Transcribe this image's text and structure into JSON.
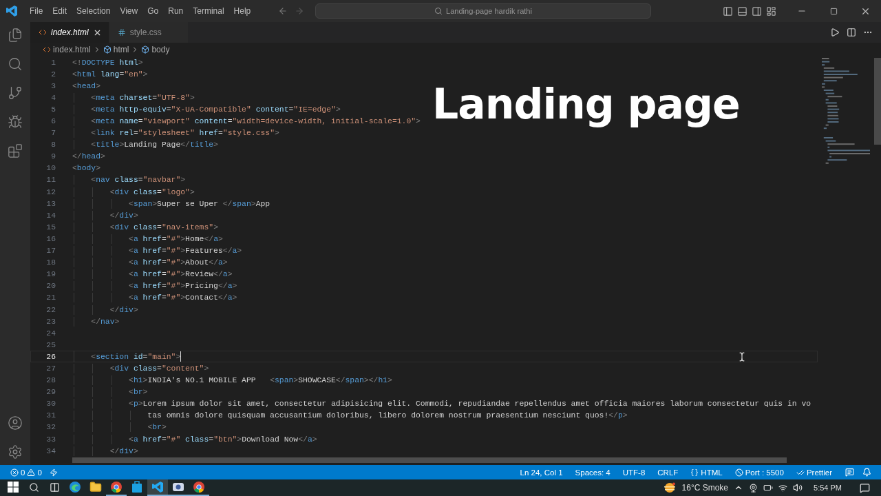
{
  "title_bar": {
    "menu": [
      "File",
      "Edit",
      "Selection",
      "View",
      "Go",
      "Run",
      "Terminal",
      "Help"
    ],
    "command_center": "Landing-page hardik rathi"
  },
  "activity_bar": {
    "top": [
      {
        "kind": "explorer"
      },
      {
        "kind": "search"
      },
      {
        "kind": "scm"
      },
      {
        "kind": "debug"
      },
      {
        "kind": "extensions"
      }
    ],
    "bottom": [
      {
        "kind": "account"
      },
      {
        "kind": "manage"
      }
    ]
  },
  "tabs": [
    {
      "label": "index.html",
      "kind": "html",
      "selected": true
    },
    {
      "label": "style.css",
      "kind": "css",
      "selected": false
    }
  ],
  "breadcrumb": [
    {
      "label": "index.html",
      "kind": "file"
    },
    {
      "label": "html",
      "kind": "element"
    },
    {
      "label": "body",
      "kind": "element"
    }
  ],
  "editor": {
    "lines": [
      {
        "number": "1",
        "text": "<!DOCTYPE html>",
        "current": false
      },
      {
        "number": "2",
        "text": "<html lang=\"en\">",
        "current": false
      },
      {
        "number": "3",
        "text": "<head>",
        "current": false
      },
      {
        "number": "4",
        "text": "    <meta charset=\"UTF-8\">",
        "current": false
      },
      {
        "number": "5",
        "text": "    <meta http-equiv=\"X-UA-Compatible\" content=\"IE=edge\">",
        "current": false
      },
      {
        "number": "6",
        "text": "    <meta name=\"viewport\" content=\"width=device-width, initial-scale=1.0\">",
        "current": false
      },
      {
        "number": "7",
        "text": "    <link rel=\"stylesheet\" href=\"style.css\">",
        "current": false
      },
      {
        "number": "8",
        "text": "    <title>Landing Page</title>",
        "current": false
      },
      {
        "number": "9",
        "text": "</head>",
        "current": false
      },
      {
        "number": "10",
        "text": "<body>",
        "current": false
      },
      {
        "number": "11",
        "text": "    <nav class=\"navbar\">",
        "current": false
      },
      {
        "number": "12",
        "text": "        <div class=\"logo\">",
        "current": false
      },
      {
        "number": "13",
        "text": "            <span>Super se Uper </span>App",
        "current": false
      },
      {
        "number": "14",
        "text": "        </div>",
        "current": false
      },
      {
        "number": "15",
        "text": "        <div class=\"nav-items\">",
        "current": false
      },
      {
        "number": "16",
        "text": "            <a href=\"#\">Home</a>",
        "current": false
      },
      {
        "number": "17",
        "text": "            <a href=\"#\">Features</a>",
        "current": false
      },
      {
        "number": "18",
        "text": "            <a href=\"#\">About</a>",
        "current": false
      },
      {
        "number": "19",
        "text": "            <a href=\"#\">Review</a>",
        "current": false
      },
      {
        "number": "20",
        "text": "            <a href=\"#\">Pricing</a>",
        "current": false
      },
      {
        "number": "21",
        "text": "            <a href=\"#\">Contact</a>",
        "current": false
      },
      {
        "number": "22",
        "text": "        </div>",
        "current": false
      },
      {
        "number": "23",
        "text": "    </nav>",
        "current": false
      },
      {
        "number": "24",
        "current": false
      },
      {
        "number": "25",
        "current": false
      },
      {
        "number": "26",
        "text": "    <section id=\"main\">",
        "current": true
      },
      {
        "number": "27",
        "text": "        <div class=\"content\">",
        "current": false
      },
      {
        "number": "28",
        "text": "            <h1>INDIA's NO.1 MOBILE APP   <span>SHOWCASE</span></h1>",
        "current": false
      },
      {
        "number": "29",
        "text": "            <br>",
        "current": false
      },
      {
        "number": "30",
        "text": "            <p>Lorem ipsum dolor sit amet, consectetur adipisicing elit. Commodi, repudiandae repellendus amet officia maiores laborum consectetur quis in vo",
        "current": false
      },
      {
        "number": "31",
        "text": "                tas omnis dolore quisquam accusantium doloribus, libero dolorem nostrum praesentium nesciunt quos!</p>",
        "current": false
      },
      {
        "number": "32",
        "text": "                <br>",
        "current": false
      },
      {
        "number": "33",
        "text": "            <a href=\"#\" class=\"btn\">Download Now</a>",
        "current": false
      },
      {
        "number": "34",
        "text": "        </div>",
        "current": false
      }
    ]
  },
  "overlay_title": "Landing page",
  "status_bar": {
    "errors": "0",
    "warnings": "0",
    "items": [
      {
        "label": "Ln 24, Col 1",
        "kind": "plain"
      },
      {
        "label": "Spaces: 4",
        "kind": "plain"
      },
      {
        "label": "UTF-8",
        "kind": "plain"
      },
      {
        "label": "CRLF",
        "kind": "plain"
      },
      {
        "label": "HTML",
        "kind": "language"
      },
      {
        "label": "Port : 5500",
        "kind": "port"
      },
      {
        "label": "Prettier",
        "kind": "formatter"
      }
    ]
  },
  "taskbar": {
    "apps": [
      {
        "kind": "edge",
        "running": false,
        "active": false
      },
      {
        "kind": "folder",
        "running": false,
        "active": false
      },
      {
        "kind": "chrome",
        "running": true,
        "active": false
      },
      {
        "kind": "store",
        "running": false,
        "active": false
      },
      {
        "kind": "vscode",
        "running": true,
        "active": true
      },
      {
        "kind": "camera",
        "running": true,
        "active": false
      },
      {
        "kind": "chrome",
        "running": true,
        "active": false
      }
    ],
    "weather": "16°C Smoke",
    "clock": "5:54 PM"
  }
}
